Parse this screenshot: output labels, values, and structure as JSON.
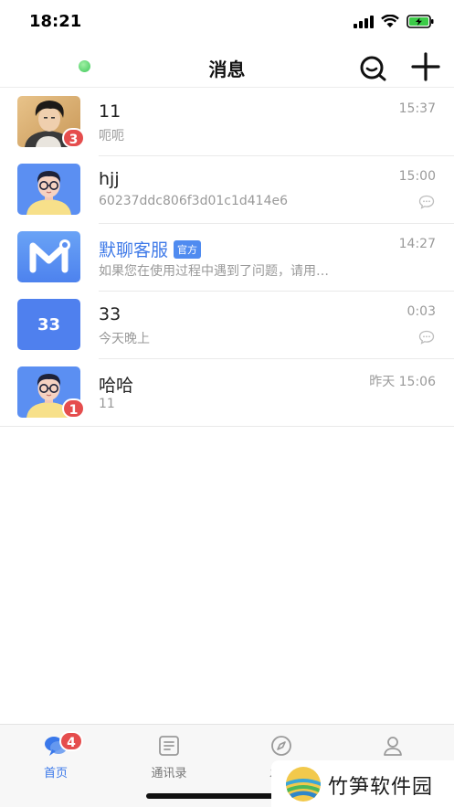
{
  "status_bar": {
    "time": "18:21"
  },
  "nav": {
    "title": "消息"
  },
  "conversations": [
    {
      "name": "11",
      "preview": "呃呃",
      "time": "15:37",
      "unread": "3"
    },
    {
      "name": "hjj",
      "preview": "60237ddc806f3d01c1d414e6",
      "time": "15:00"
    },
    {
      "name": "默聊客服",
      "tag": "官方",
      "preview": "如果您在使用过程中遇到了问题，请用…",
      "time": "14:27"
    },
    {
      "name": "33",
      "avatar_text": "33",
      "preview": "今天晚上",
      "time": "0:03"
    },
    {
      "name": "哈哈",
      "preview": "11",
      "time": "昨天 15:06",
      "unread": "1"
    }
  ],
  "tab_bar": {
    "tabs": [
      {
        "label": "首页",
        "badge": "4"
      },
      {
        "label": "通讯录"
      },
      {
        "label": "发现"
      },
      {
        "label": "我的"
      }
    ]
  },
  "watermark": {
    "text": "竹笋软件园"
  },
  "colors": {
    "accent": "#3a78ea",
    "badge": "#e54d4d",
    "online": "#3fc85a"
  }
}
